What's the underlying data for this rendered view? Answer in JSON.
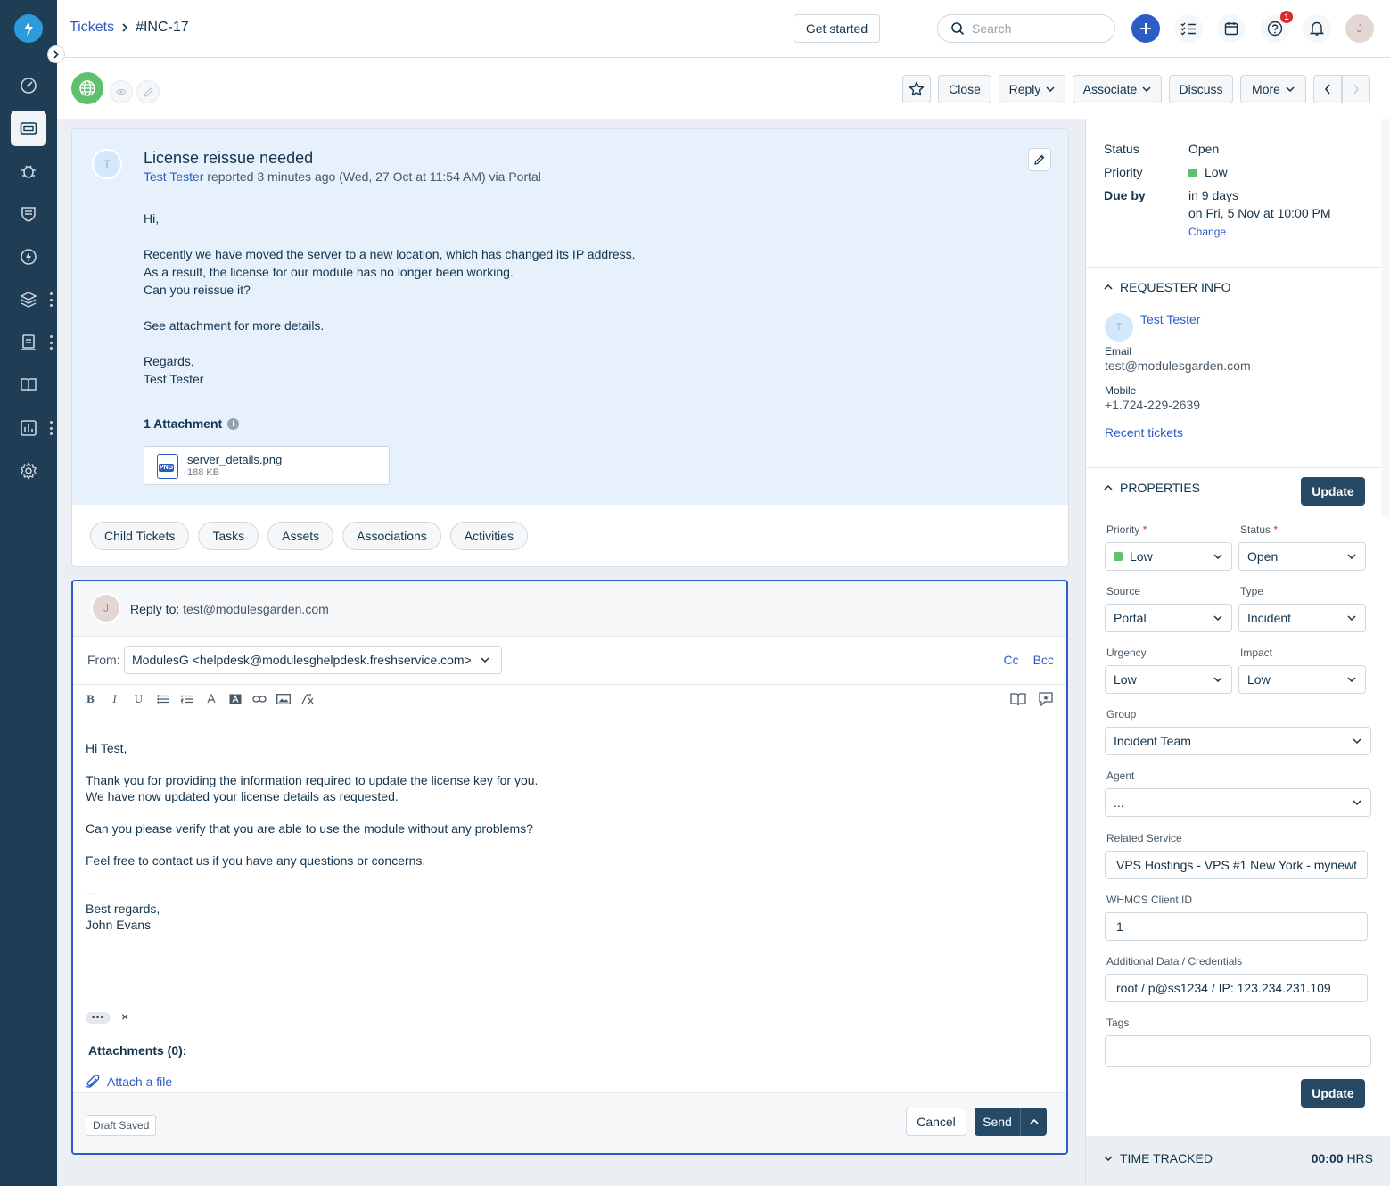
{
  "header": {
    "breadcrumb_root": "Tickets",
    "breadcrumb_current": "#INC-17",
    "get_started": "Get started",
    "search_placeholder": "Search",
    "help_badge": "1",
    "user_initial": "J"
  },
  "toolbar": {
    "close": "Close",
    "reply": "Reply",
    "associate": "Associate",
    "discuss": "Discuss",
    "more": "More"
  },
  "ticket": {
    "avatar_initial": "T",
    "subject": "License reissue needed",
    "requester": "Test Tester",
    "meta_suffix": " reported 3 minutes ago (Wed, 27 Oct at 11:54 AM) via Portal",
    "body": {
      "greeting": "Hi,",
      "line1": "Recently we have moved the server to a new location, which has changed its IP address.",
      "line2": "As a result, the license for our module has no longer been working.",
      "line3": "Can you reissue it?",
      "line4": "See attachment for more details.",
      "sign1": "Regards,",
      "sign2": "Test Tester"
    },
    "attachments_title": "1 Attachment",
    "attachment": {
      "type": "PNG",
      "name": "server_details.png",
      "size": "188 KB"
    },
    "tabs": [
      "Child Tickets",
      "Tasks",
      "Assets",
      "Associations",
      "Activities"
    ]
  },
  "reply": {
    "avatar_initial": "J",
    "reply_to_label": "Reply to: ",
    "reply_to_value": "test@modulesgarden.com",
    "from_label": "From:",
    "from_value": "ModulesG <helpdesk@modulesghelpdesk.freshservice.com>",
    "cc": "Cc",
    "bcc": "Bcc",
    "body": {
      "l1": "Hi Test,",
      "l2": "Thank you for providing the information required to update the license key for you.",
      "l3": "We have now updated your license details as requested.",
      "l4": "Can you please verify that you are able to use the module without any problems?",
      "l5": "Feel free to contact us if you have any questions or concerns.",
      "l6": "--",
      "l7": "Best regards,",
      "l8": "John Evans"
    },
    "ellipsis": "•••",
    "remove": "×",
    "attachments_title": "Attachments (0):",
    "attach_link": "Attach a file",
    "draft_status": "Draft Saved",
    "cancel": "Cancel",
    "send": "Send"
  },
  "summary": {
    "status_label": "Status",
    "status_value": "Open",
    "priority_label": "Priority",
    "priority_value": "Low",
    "due_label": "Due by",
    "due_relative": "in 9 days",
    "due_absolute": "on Fri, 5 Nov at 10:00 PM",
    "change": "Change"
  },
  "requester": {
    "section_title": "REQUESTER INFO",
    "initial": "T",
    "name": "Test Tester",
    "email_label": "Email",
    "email": "test@modulesgarden.com",
    "mobile_label": "Mobile",
    "mobile": "+1.724-229-2639",
    "recent": "Recent tickets"
  },
  "properties": {
    "section_title": "PROPERTIES",
    "update": "Update",
    "priority_label": "Priority",
    "priority_value": "Low",
    "status_label": "Status",
    "status_value": "Open",
    "source_label": "Source",
    "source_value": "Portal",
    "type_label": "Type",
    "type_value": "Incident",
    "urgency_label": "Urgency",
    "urgency_value": "Low",
    "impact_label": "Impact",
    "impact_value": "Low",
    "group_label": "Group",
    "group_value": "Incident Team",
    "agent_label": "Agent",
    "agent_value": "...",
    "service_label": "Related Service",
    "service_value": "VPS Hostings - VPS #1 New York - mynewt",
    "whmcs_label": "WHMCS Client ID",
    "whmcs_value": "1",
    "additional_label": "Additional Data / Credentials",
    "additional_value": "root / p@ss1234 / IP: 123.234.231.109",
    "tags_label": "Tags",
    "tags_value": "",
    "required_mark": "*"
  },
  "time_tracked": {
    "title": "TIME TRACKED",
    "value": "00:00",
    "unit": "HRS"
  },
  "colors": {
    "nav_bg": "#1f3d54",
    "accent": "#2c5cc5",
    "primary_btn": "#264966",
    "priority_low": "#5fc16d",
    "ticket_bg": "#e6f1fc"
  }
}
